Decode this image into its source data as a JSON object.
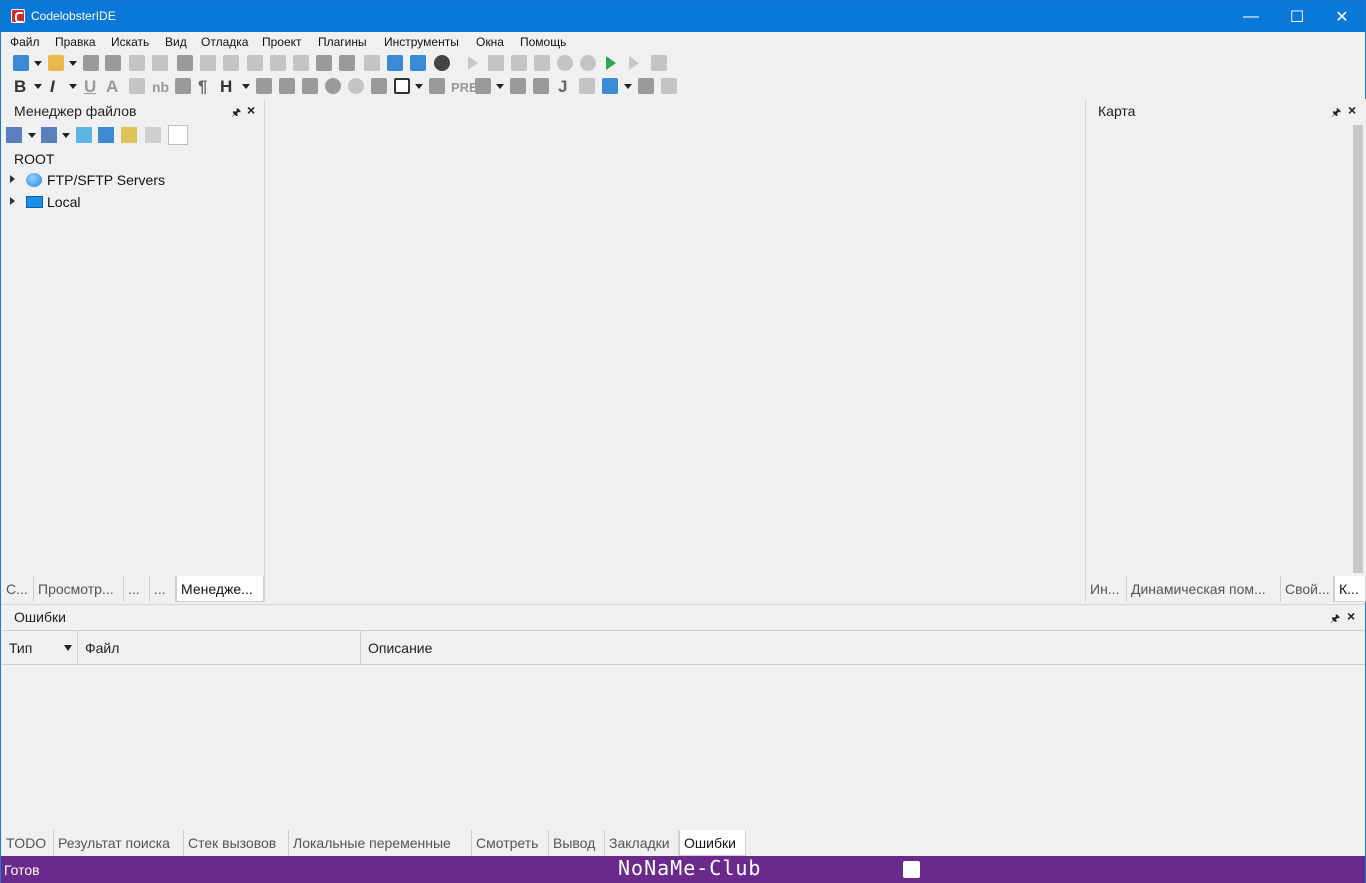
{
  "window": {
    "title": "CodelobsterIDE"
  },
  "menu": [
    "Файл",
    "Правка",
    "Искать",
    "Вид",
    "Отладка",
    "Проект",
    "Плагины",
    "Инструменты",
    "Окна",
    "Помощь"
  ],
  "left_panel": {
    "title": "Менеджер файлов",
    "tree": {
      "root": "ROOT",
      "items": [
        "FTP/SFTP Servers",
        "Local"
      ]
    },
    "tabs": [
      "С...",
      "Просмотр...",
      "...",
      "...",
      "Менедже..."
    ]
  },
  "right_panel": {
    "title": "Карта",
    "tabs": [
      "Ин...",
      "Динамическая пом...",
      "Свой...",
      "К..."
    ]
  },
  "bottom_panel": {
    "title": "Ошибки",
    "columns": [
      "Тип",
      "Файл",
      "Описание"
    ],
    "tabs": [
      "TODO",
      "Результат поиска",
      "Стек вызовов",
      "Локальные переменные",
      "Смотреть",
      "Вывод",
      "Закладки",
      "Ошибки"
    ]
  },
  "statusbar": {
    "text": "Готов",
    "watermark": "NoNaMe-Club"
  },
  "colors": {
    "titlebar": "#0a78d7",
    "statusbar": "#6a2a8c"
  }
}
